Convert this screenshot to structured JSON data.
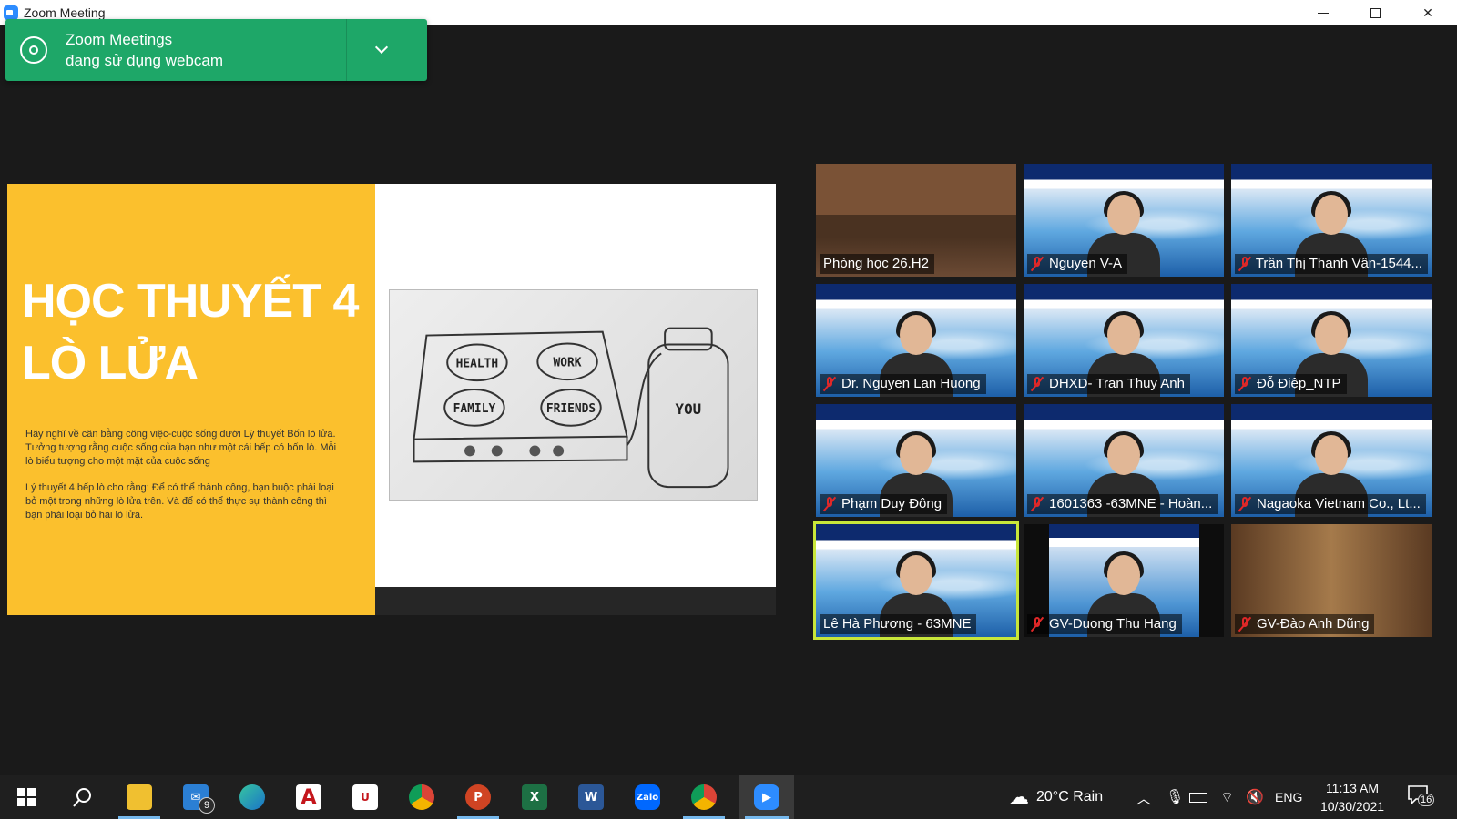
{
  "window": {
    "title": "Zoom Meeting"
  },
  "notification": {
    "line1": "Zoom Meetings",
    "line2": "đang sử dụng webcam"
  },
  "slide": {
    "title_line1": "HỌC THUYẾT 4",
    "title_line2": "LÒ LỬA",
    "paragraph1": "Hãy nghĩ về cân bằng công việc-cuộc sống dưới Lý thuyết Bốn lò lửa. Tưởng tượng rằng cuộc sống của bạn như một cái bếp có bốn lò. Mỗi lò biểu tượng cho một mặt của cuộc sống",
    "paragraph2": "Lý thuyết 4 bếp lò cho rằng: Để có thể thành công, bạn buộc phải loại bỏ một trong những lò lửa trên. Và để có thể thực sự thành công thì bạn phải loại bỏ hai lò lửa.",
    "sketch_labels": {
      "health": "HEALTH",
      "work": "WORK",
      "family": "FAMILY",
      "friends": "FRIENDS",
      "you": "YOU"
    }
  },
  "participants": [
    {
      "name": "Phòng học 26.H2",
      "muted": false,
      "bg": "room"
    },
    {
      "name": "Nguyen V-A",
      "muted": true,
      "bg": "banner"
    },
    {
      "name": "Trần Thị Thanh Vân-1544...",
      "muted": true,
      "bg": "banner"
    },
    {
      "name": "Dr. Nguyen Lan Huong",
      "muted": true,
      "bg": "banner"
    },
    {
      "name": "DHXD- Tran Thuy Anh",
      "muted": true,
      "bg": "banner"
    },
    {
      "name": "Đỗ Điệp_NTP",
      "muted": true,
      "bg": "banner"
    },
    {
      "name": "Phạm Duy Đông",
      "muted": true,
      "bg": "banner"
    },
    {
      "name": "1601363 -63MNE - Hoàn...",
      "muted": true,
      "bg": "banner"
    },
    {
      "name": "Nagaoka Vietnam Co., Lt...",
      "muted": true,
      "bg": "banner"
    },
    {
      "name": "Lê Hà Phương - 63MNE",
      "muted": false,
      "bg": "banner",
      "active": true
    },
    {
      "name": "GV-Duong Thu Hang",
      "muted": true,
      "bg": "mini"
    },
    {
      "name": "GV-Đào Anh Dũng",
      "muted": true,
      "bg": "hall"
    }
  ],
  "taskbar": {
    "mail_badge": "9",
    "weather": "20°C  Rain",
    "language": "ENG",
    "time": "11:13 AM",
    "date": "10/30/2021",
    "notifications": "16"
  }
}
